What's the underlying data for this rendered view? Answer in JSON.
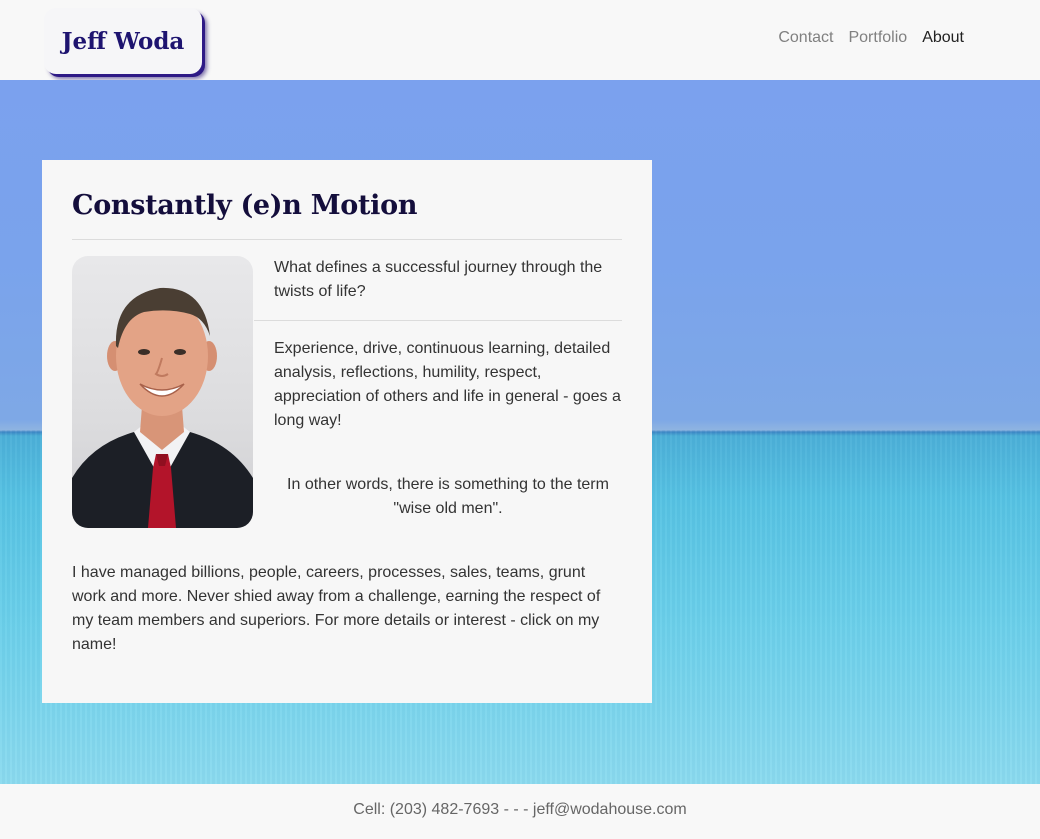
{
  "header": {
    "logo_text": "Jeff Woda",
    "nav": [
      {
        "label": "Contact"
      },
      {
        "label": "Portfolio"
      },
      {
        "label": "About",
        "active": true
      }
    ]
  },
  "card": {
    "title": "Constantly (e)n Motion",
    "intro": "What defines a successful journey through the twists of life?",
    "answer": "Experience, drive, continuous learning, detailed analysis, reflections, humility, respect, appreciation of others and life in general - goes a long way!",
    "quote": "In other words, there is something to the term \"wise old men\".",
    "body": "I have managed billions, people, careers, processes, sales, teams, grunt work and more. Never shied away from a challenge, earning the respect of my team members and superiors. For more details or interest - click on my name!"
  },
  "footer": {
    "text": "Cell: (203) 482-7693 - - - jeff@wodahouse.com"
  },
  "colors": {
    "logo_text": "#1e1470",
    "title": "#140e3c",
    "sky": "#7ba1ee",
    "sea": "#57c3e3"
  }
}
